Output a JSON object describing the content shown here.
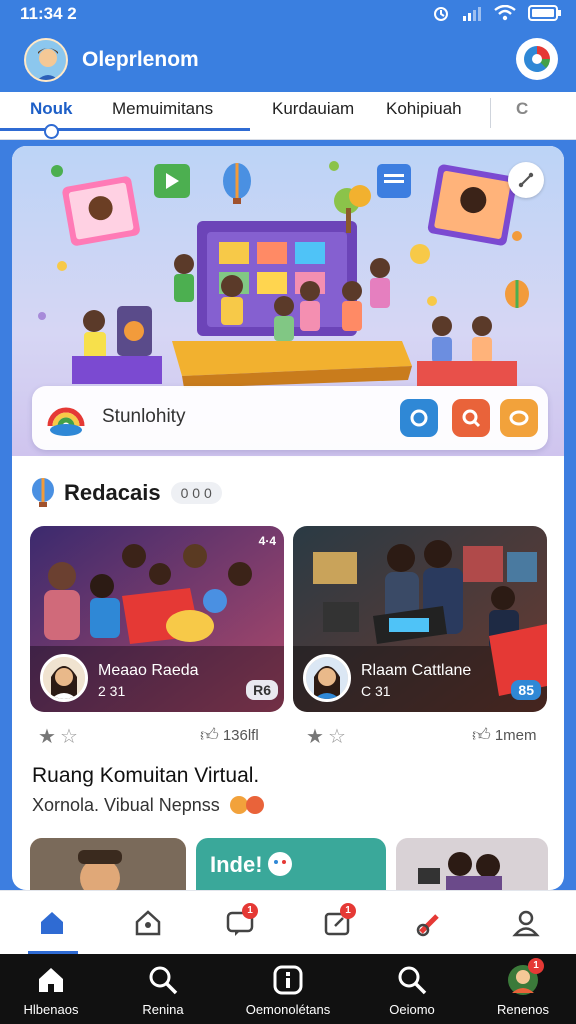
{
  "status": {
    "time": "11:34 2"
  },
  "app": {
    "title": "Oleprlenom"
  },
  "tabs": [
    {
      "label": "Nouk"
    },
    {
      "label": "Memuimitans"
    },
    {
      "label": "Kurdauiam"
    },
    {
      "label": "Kohipiuah"
    },
    {
      "label": "C"
    }
  ],
  "search": {
    "label": "Stunlohity"
  },
  "section": {
    "title": "Redacais",
    "chip": "0 0 0"
  },
  "cards": [
    {
      "name": "Meaao Raeda",
      "sub": "2 31",
      "badge": "R6",
      "corner": "4·4"
    },
    {
      "name": "Rlaam Cattlane",
      "sub": "C 31",
      "badge": "85",
      "corner": ""
    }
  ],
  "meta": [
    {
      "right": "136lfl"
    },
    {
      "right": "1mem"
    }
  ],
  "body": {
    "title": "Ruang Komuitan Virtual.",
    "subtitle": "Xornola. Vibual Nepnss"
  },
  "thumbs": [
    {
      "label": ""
    },
    {
      "label": "Inde! "
    },
    {
      "label": ""
    }
  ],
  "inner_nav": {
    "badges": [
      "1",
      "1"
    ]
  },
  "sys_nav": [
    {
      "label": "Hlbenaos"
    },
    {
      "label": "Renina"
    },
    {
      "label": "Oemonolétans"
    },
    {
      "label": "Oeiomo"
    },
    {
      "label": "Renenos"
    }
  ],
  "colors": {
    "primary": "#3a7fe0",
    "accent_red": "#e53935",
    "accent_orange": "#e9633a",
    "accent_blue": "#2f88d6"
  },
  "icons": {
    "status": [
      "alarm-icon",
      "signal-icon",
      "wifi-icon",
      "battery-icon"
    ],
    "search_buttons": [
      "camera-icon",
      "search-icon",
      "chat-icon"
    ],
    "inner_nav": [
      "home-icon",
      "house-icon",
      "message-icon",
      "edit-icon",
      "pen-icon",
      "profile-icon"
    ],
    "sys_nav": [
      "home-icon",
      "search-icon",
      "info-icon",
      "search-icon",
      "avatar-icon"
    ]
  }
}
